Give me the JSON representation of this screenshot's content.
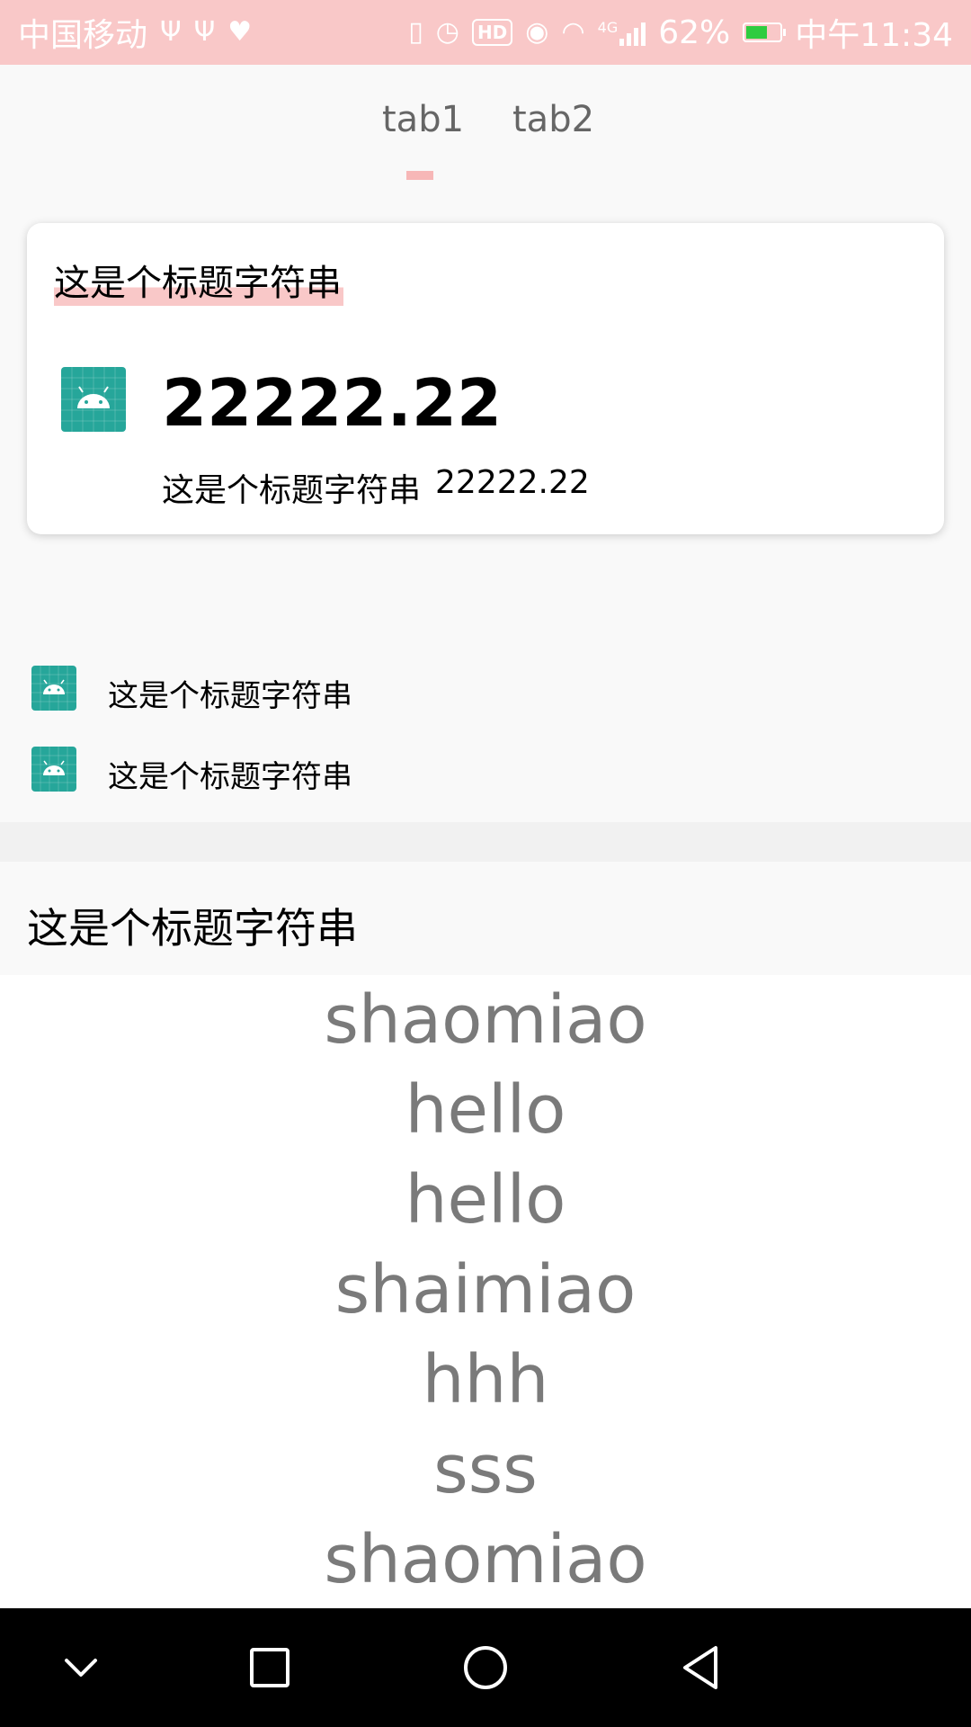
{
  "status_bar": {
    "carrier": "中国移动",
    "icons_left": [
      "usb-icon",
      "usb-icon",
      "heart-monitor-icon"
    ],
    "icons_right": [
      "vibrate-icon",
      "alarm-icon",
      "hd-icon",
      "eye-comfort-icon",
      "wifi-icon",
      "4g-signal-icon",
      "battery-icon"
    ],
    "hd_label": "HD",
    "network_label": "4G",
    "battery_percent": "62%",
    "battery_level": 0.62,
    "time": "中午11:34",
    "background_color": "#f9c8c8"
  },
  "tabs": {
    "items": [
      {
        "label": "tab1",
        "selected": true
      },
      {
        "label": "tab2",
        "selected": false
      }
    ],
    "indicator_color": "#f7b7b7"
  },
  "card": {
    "title": "这是个标题字符串",
    "icon": "android-icon",
    "amount": "22222.22",
    "sub_label": "这是个标题字符串",
    "sub_amount": "22222.22"
  },
  "list": {
    "items": [
      {
        "icon": "android-icon",
        "label": "这是个标题字符串"
      },
      {
        "icon": "android-icon",
        "label": "这是个标题字符串"
      }
    ]
  },
  "section": {
    "title": "这是个标题字符串"
  },
  "word_list": {
    "items": [
      "shaomiao",
      "hello",
      "hello",
      "shaimiao",
      "hhh",
      "sss",
      "shaomiao"
    ],
    "text_color": "#7a7a7a"
  },
  "nav_bar": {
    "buttons": [
      "chevron-down-icon",
      "square-recents-icon",
      "circle-home-icon",
      "triangle-back-icon"
    ]
  },
  "colors": {
    "accent_pink": "#f9c8c8",
    "android_teal": "#26a69a"
  }
}
